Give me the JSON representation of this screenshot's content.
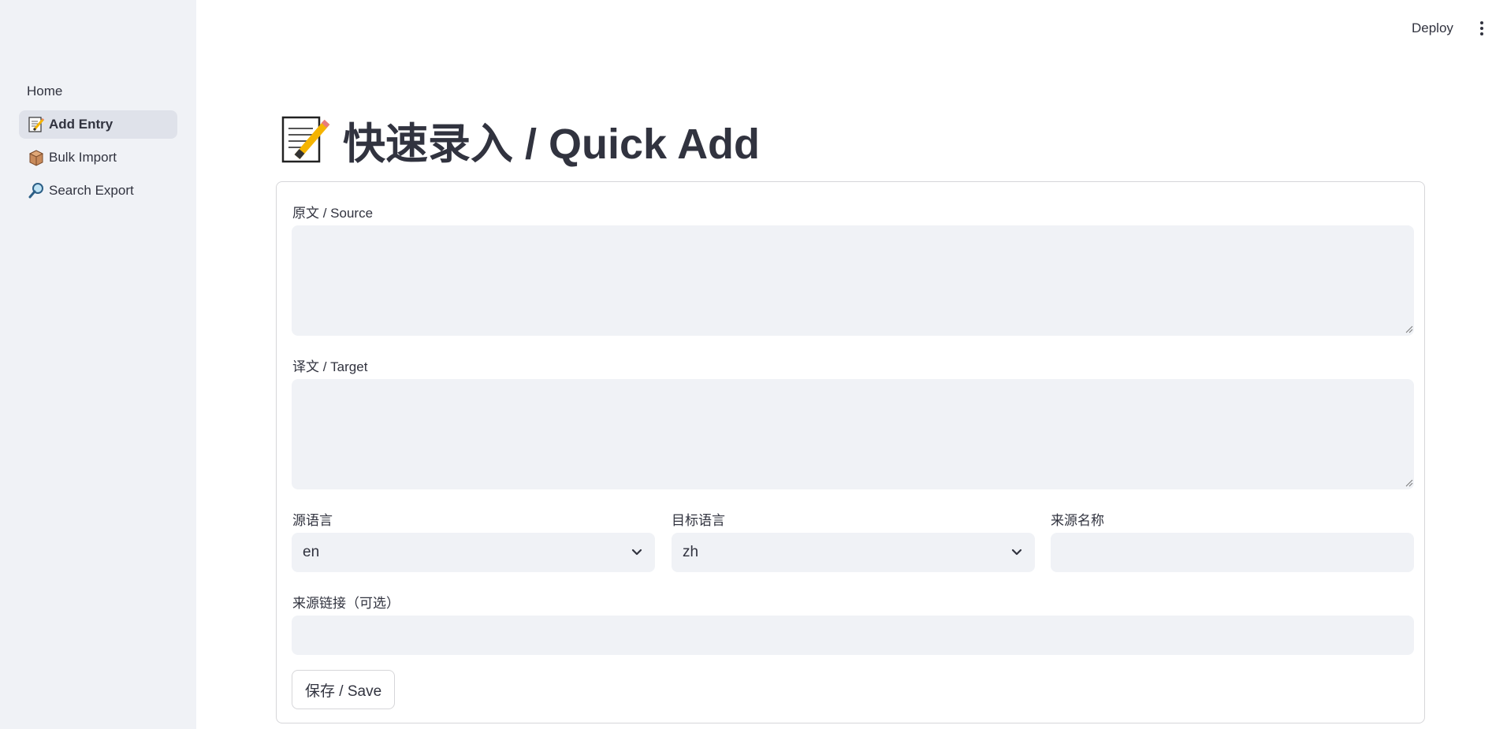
{
  "sidebar": {
    "items": [
      {
        "label": "Home",
        "icon": "",
        "active": false
      },
      {
        "label": "Add Entry",
        "icon": "memo-icon",
        "active": true
      },
      {
        "label": "Bulk Import",
        "icon": "package-icon",
        "active": false
      },
      {
        "label": "Search Export",
        "icon": "magnifier-icon",
        "active": false
      }
    ]
  },
  "header": {
    "deploy_label": "Deploy",
    "menu_icon": "kebab-menu-icon"
  },
  "main": {
    "title_icon": "memo-icon",
    "title": "快速录入 / Quick Add",
    "form": {
      "source_label": "原文 / Source",
      "source_value": "",
      "target_label": "译文 / Target",
      "target_value": "",
      "source_lang_label": "源语言",
      "source_lang_value": "en",
      "target_lang_label": "目标语言",
      "target_lang_value": "zh",
      "source_name_label": "来源名称",
      "source_name_value": "",
      "source_link_label": "来源链接（可选）",
      "source_link_value": "",
      "save_label": "保存 / Save"
    }
  },
  "colors": {
    "sidebar_bg": "#f0f2f6",
    "active_item_bg": "#dfe2ea",
    "input_bg": "#f0f2f6",
    "text": "#31333f",
    "border": "#d6d6d9"
  }
}
